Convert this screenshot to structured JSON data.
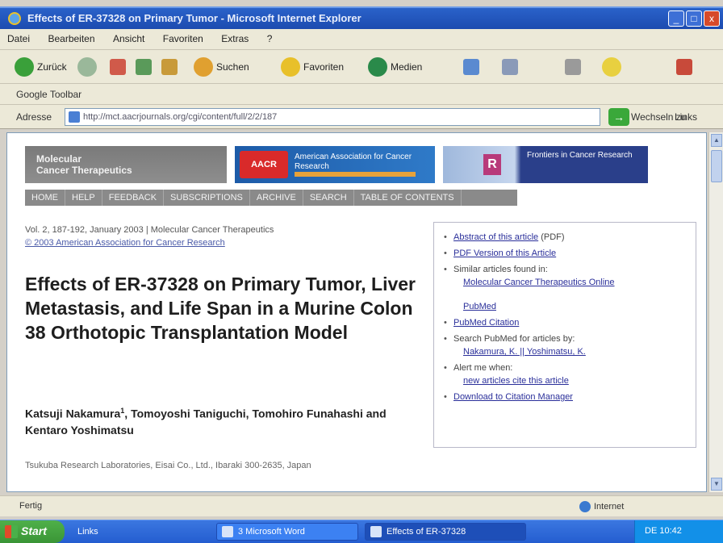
{
  "window": {
    "title": "Effects of ER-37328 on Primary Tumor - Microsoft Internet Explorer",
    "buttons": [
      "_",
      "□",
      "x"
    ]
  },
  "menu": [
    "Datei",
    "Bearbeiten",
    "Ansicht",
    "Favoriten",
    "Extras",
    "?"
  ],
  "toolbar": {
    "back": "Zurück",
    "search": "Suchen",
    "favorites": "Favoriten",
    "media": "Medien"
  },
  "linksbar": {
    "label": "Google Toolbar"
  },
  "address": {
    "label": "Adresse",
    "url": "http://mct.aacrjournals.org/cgi/content/full/2/2/187",
    "go": "Wechseln zu",
    "links": "Links"
  },
  "banners": {
    "left": [
      "Molecular",
      "Cancer Therapeutics"
    ],
    "middle": {
      "logo": "AACR",
      "text": "American Association for Cancer Research"
    },
    "right": {
      "logo": "R",
      "text": "Frontiers in Cancer Research"
    }
  },
  "nav": [
    "HOME",
    "HELP",
    "FEEDBACK",
    "SUBSCRIPTIONS",
    "ARCHIVE",
    "SEARCH",
    "TABLE OF CONTENTS"
  ],
  "citation": {
    "line1": "Vol. 2, 187-192, January 2003 | Molecular Cancer Therapeutics",
    "line2": "© 2003 American Association for Cancer Research"
  },
  "article": {
    "title": "Effects of ER-37328 on Primary Tumor, Liver Metastasis, and Life Span in a Murine Colon 38 Orthotopic Transplantation Model",
    "authors_a": "Katsuji Nakamura",
    "authors_sup": "1",
    "authors_b": ", Tomoyoshi Taniguchi, Tomohiro Funahashi and Kentaro Yoshimatsu",
    "affiliation": "Tsukuba Research Laboratories, Eisai Co., Ltd., Ibaraki 300-2635, Japan"
  },
  "sidebox": {
    "items": [
      {
        "link": "Abstract of this article",
        "rest": " (PDF)"
      },
      {
        "link": "PDF Version of this Article",
        "rest": ""
      },
      {
        "link": "",
        "rest": "Similar articles found in:"
      },
      {
        "link": "Molecular Cancer Therapeutics Online",
        "rest": ""
      },
      {
        "link": "PubMed",
        "rest": ""
      },
      {
        "link": "PubMed Citation",
        "rest": ""
      },
      {
        "link": "",
        "rest": "Search PubMed for articles by:"
      },
      {
        "link": "Nakamura, K. || Yoshimatsu, K.",
        "rest": ""
      },
      {
        "link": "",
        "rest": "Alert me when:"
      },
      {
        "link": "new articles cite this article",
        "rest": ""
      },
      {
        "link": "Download to Citation Manager",
        "rest": ""
      }
    ]
  },
  "status": {
    "text": "Fertig",
    "zone": "Internet"
  },
  "taskbar": {
    "start": "Start",
    "tasks": [
      {
        "label": "Links"
      },
      {
        "label": "3 Microsoft Word"
      },
      {
        "label": "Effects of ER-37328"
      }
    ],
    "clock": "DE  10:42"
  },
  "colors": {
    "titlebar": "#1c4bb0",
    "link": "#2a2f9a",
    "banner_gray": "#8e8e8e",
    "banner_blue": "#1d5ba8"
  }
}
